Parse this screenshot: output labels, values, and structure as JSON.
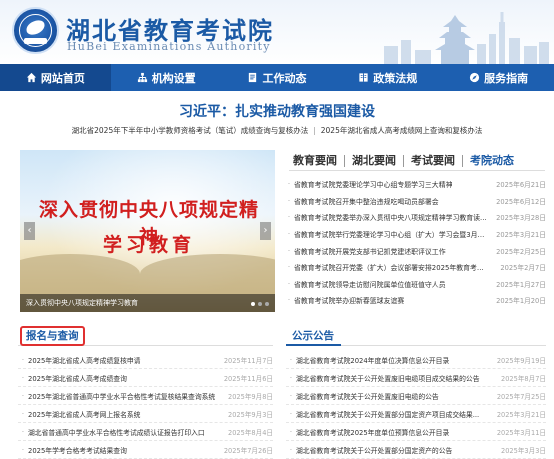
{
  "header": {
    "site_title": "湖北省教育考试院",
    "site_subtitle": "HuBei Examinations Authority"
  },
  "nav": [
    {
      "label": "网站首页",
      "icon": "home-icon"
    },
    {
      "label": "机构设置",
      "icon": "org-chart-icon"
    },
    {
      "label": "工作动态",
      "icon": "document-icon"
    },
    {
      "label": "政策法规",
      "icon": "book-icon"
    },
    {
      "label": "服务指南",
      "icon": "compass-icon"
    }
  ],
  "headline": "习近平：扎实推动教育强国建设",
  "sub_links": [
    "湖北省2025年下半年中小学教师资格考试（笔试）成绩查询与复核办法",
    "2025年湖北省成人高考成绩网上查询和复核办法"
  ],
  "slider": {
    "text_line1": "深入贯彻中央八项规定精神",
    "text_line2": "学习教育",
    "caption": "深入贯彻中央八项规定精神学习教育",
    "prev": "‹",
    "next": "›"
  },
  "news": {
    "tabs": [
      "教育要闻",
      "湖北要闻",
      "考试要闻",
      "考院动态"
    ],
    "active_tab": "考院动态",
    "items": [
      {
        "title": "省教育考试院党委理论学习中心组专题学习三大精神",
        "date": "2025年6月21日"
      },
      {
        "title": "省教育考试院召开集中整治违规吃喝动员部署会",
        "date": "2025年6月12日"
      },
      {
        "title": "省教育考试院党委举办深入贯彻中央八项规定精神学习教育读...",
        "date": "2025年3月28日"
      },
      {
        "title": "省教育考试院举行党委理论学习中心组（扩大）学习会暨3月份...",
        "date": "2025年3月21日"
      },
      {
        "title": "省教育考试院开展党支部书记抓党建述职评议工作",
        "date": "2025年2月25日"
      },
      {
        "title": "省教育考试院召开党委（扩大）会议部署安排2025年教育考试...",
        "date": "2025年2月7日"
      },
      {
        "title": "省教育考试院领导走访慰问院属单位值班值守人员",
        "date": "2025年1月27日"
      },
      {
        "title": "省教育考试院举办迎新春篮球友谊赛",
        "date": "2025年1月20日"
      }
    ]
  },
  "panel_left": {
    "title": "报名与查询",
    "items": [
      {
        "title": "2025年湖北省成人高考成绩复核申请",
        "date": "2025年11月7日"
      },
      {
        "title": "2025年湖北省成人高考成绩查询",
        "date": "2025年11月6日"
      },
      {
        "title": "2025年湖北省普通高中学业水平合格性考试复核结果查询系统",
        "date": "2025年9月8日"
      },
      {
        "title": "2025年湖北省成人高考网上报名系统",
        "date": "2025年9月3日"
      },
      {
        "title": "湖北省普通高中学业水平合格性考试成绩认证报告打印入口",
        "date": "2025年8月4日"
      },
      {
        "title": "2025年学考合格考考试结果查询",
        "date": "2025年7月26日"
      }
    ]
  },
  "panel_right": {
    "title": "公示公告",
    "items": [
      {
        "title": "湖北省教育考试院2024年度单位决算信息公开目录",
        "date": "2025年9月19日"
      },
      {
        "title": "湖北省教育考试院关于公开处置废旧电缆项目成交结果的公告",
        "date": "2025年8月7日"
      },
      {
        "title": "湖北省教育考试院关于公开处置废旧电缆的公告",
        "date": "2025年7月25日"
      },
      {
        "title": "湖北省教育考试院关于公开处置部分国定资产项目成交结果...",
        "date": "2025年3月21日"
      },
      {
        "title": "湖北省教育考试院2025年度单位预算信息公开目录",
        "date": "2025年3月11日"
      },
      {
        "title": "湖北省教育考试院关于公开处置部分国定资产的公告",
        "date": "2025年3月3日"
      }
    ]
  },
  "colors": {
    "brand_blue": "#1b5aa5",
    "nav_blue": "#1d5fb0",
    "nav_active": "#14498f",
    "highlight_red": "#e03030",
    "slider_text_red": "#d11f1f"
  }
}
